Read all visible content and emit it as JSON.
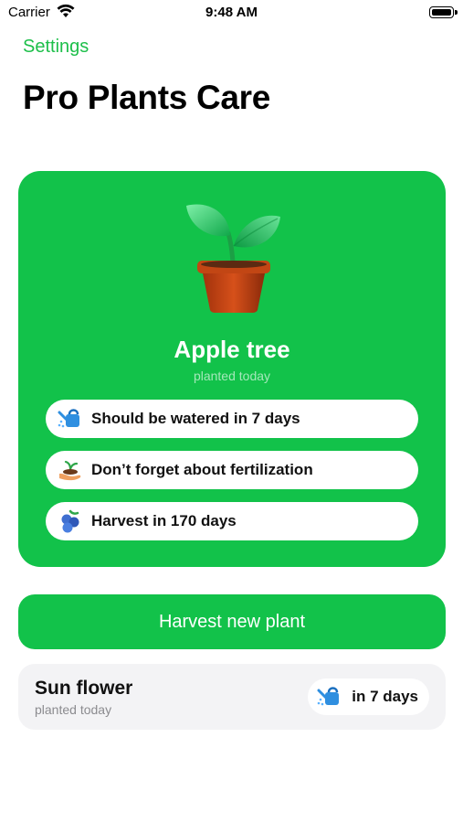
{
  "status_bar": {
    "carrier": "Carrier",
    "time": "9:48 AM"
  },
  "nav": {
    "back_label": "Settings"
  },
  "title": "Pro Plants Care",
  "plant_card": {
    "name": "Apple tree",
    "subtitle": "planted today",
    "tasks": [
      {
        "icon": "watering-can-icon",
        "label": "Should be watered in 7 days"
      },
      {
        "icon": "fertilizer-hand-icon",
        "label": "Don’t forget about fertilization"
      },
      {
        "icon": "berries-icon",
        "label": "Harvest in 170 days"
      }
    ]
  },
  "harvest_button": {
    "label": "Harvest new plant"
  },
  "plants_list": [
    {
      "name": "Sun flower",
      "subtitle": "planted today",
      "water_label": "in 7 days",
      "water_icon": "watering-can-icon"
    }
  ],
  "colors": {
    "accent": "#12c24a",
    "link": "#1dbf4a"
  }
}
